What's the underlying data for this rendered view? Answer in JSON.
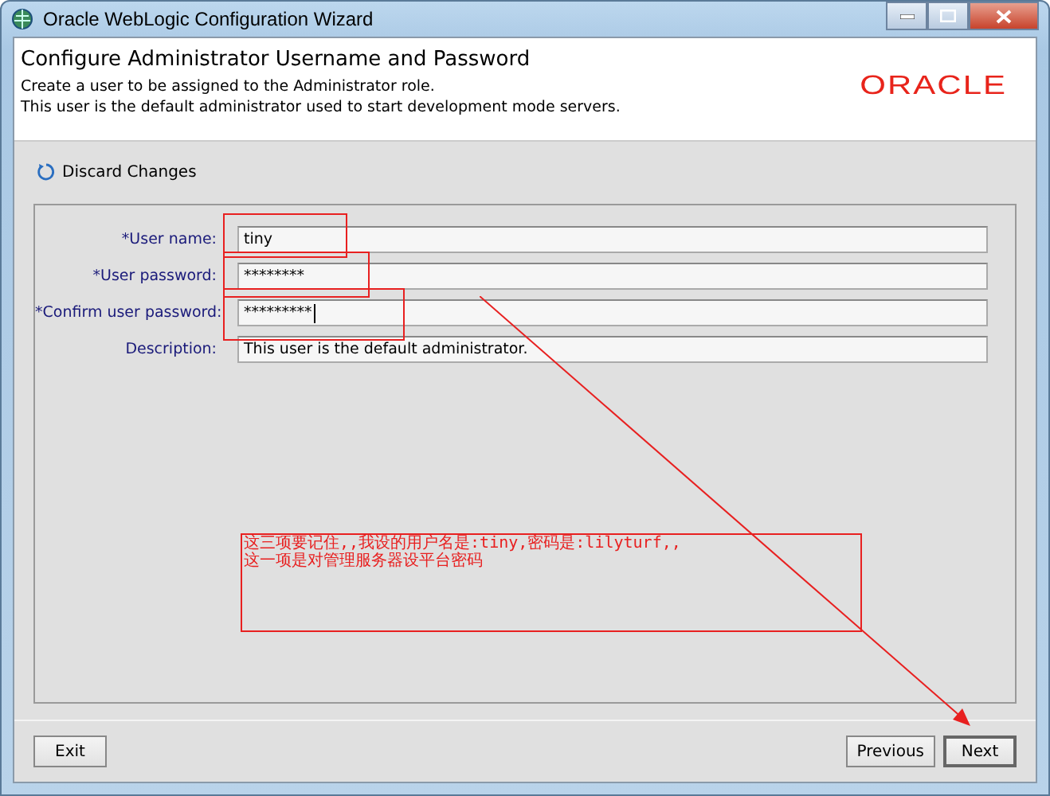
{
  "window": {
    "title": "Oracle WebLogic Configuration Wizard"
  },
  "header": {
    "title": "Configure Administrator Username and Password",
    "lines": [
      "Create a user to be assigned to the Administrator role.",
      "This user is the default administrator used to start development mode servers."
    ],
    "logo": "ORACLE"
  },
  "discard": {
    "label": "Discard Changes"
  },
  "fields": [
    {
      "label": "*User name:",
      "value": "tiny",
      "focused": false
    },
    {
      "label": "*User password:",
      "value": "********",
      "focused": false
    },
    {
      "label": "*Confirm user password:",
      "value": "*********",
      "focused": true
    },
    {
      "label": "Description:",
      "value": "This user is the default administrator.",
      "focused": false
    }
  ],
  "note": {
    "lines": [
      "这三项要记住,,我设的用户名是:tiny,密码是:lilyturf,,",
      "这一项是对管理服务器设平台密码"
    ]
  },
  "buttons": {
    "left": [
      "Exit"
    ],
    "right": [
      {
        "label": "Previous",
        "default": false
      },
      {
        "label": "Next",
        "default": true
      }
    ]
  }
}
